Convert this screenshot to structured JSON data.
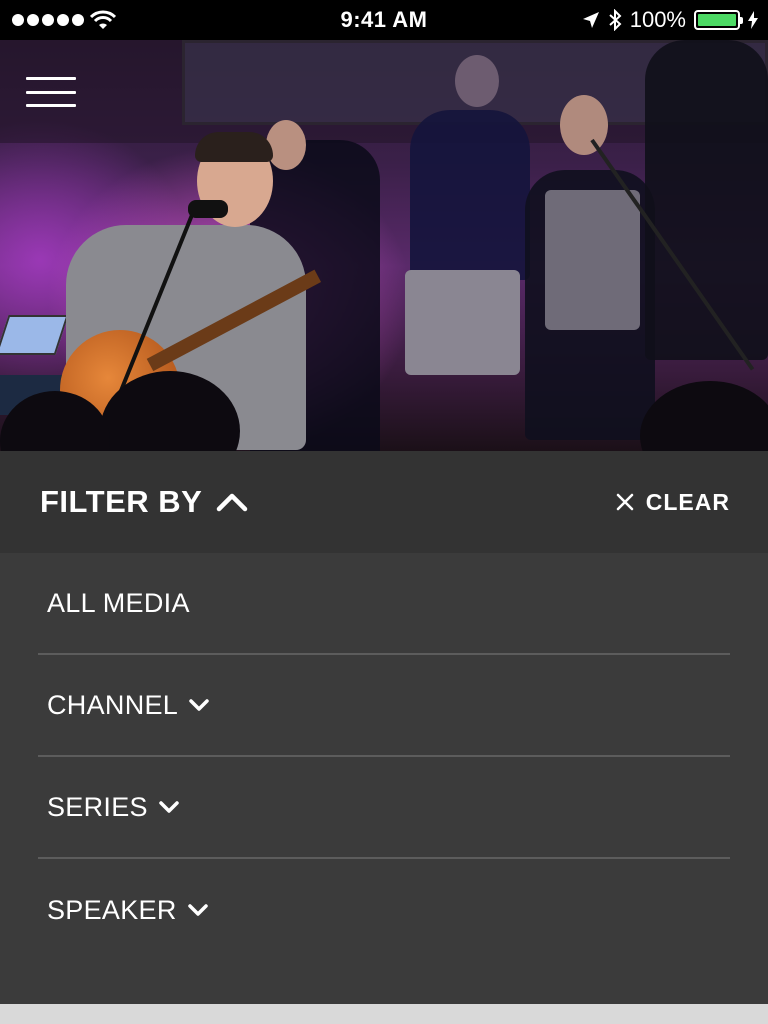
{
  "status_bar": {
    "time": "9:41 AM",
    "battery_percent": "100%",
    "battery_level": 1.0,
    "battery_color": "#4cd964",
    "icons": [
      "signal-dots-icon",
      "wifi-icon",
      "location-arrow-icon",
      "bluetooth-icon",
      "battery-icon",
      "charging-bolt-icon"
    ]
  },
  "header": {
    "menu_icon": "hamburger-menu-icon"
  },
  "filter": {
    "title": "FILTER BY",
    "title_icon": "chevron-up-icon",
    "clear_label": "CLEAR",
    "clear_icon": "close-icon",
    "items": [
      {
        "label": "ALL MEDIA",
        "expandable": false
      },
      {
        "label": "CHANNEL",
        "expandable": true,
        "icon": "chevron-down-icon"
      },
      {
        "label": "SERIES",
        "expandable": true,
        "icon": "chevron-down-icon"
      },
      {
        "label": "SPEAKER",
        "expandable": true,
        "icon": "chevron-down-icon"
      }
    ]
  },
  "colors": {
    "panel_bg": "#3b3b3b",
    "header_bg": "#333333",
    "divider": "#5c5c5c",
    "text": "#ffffff"
  }
}
